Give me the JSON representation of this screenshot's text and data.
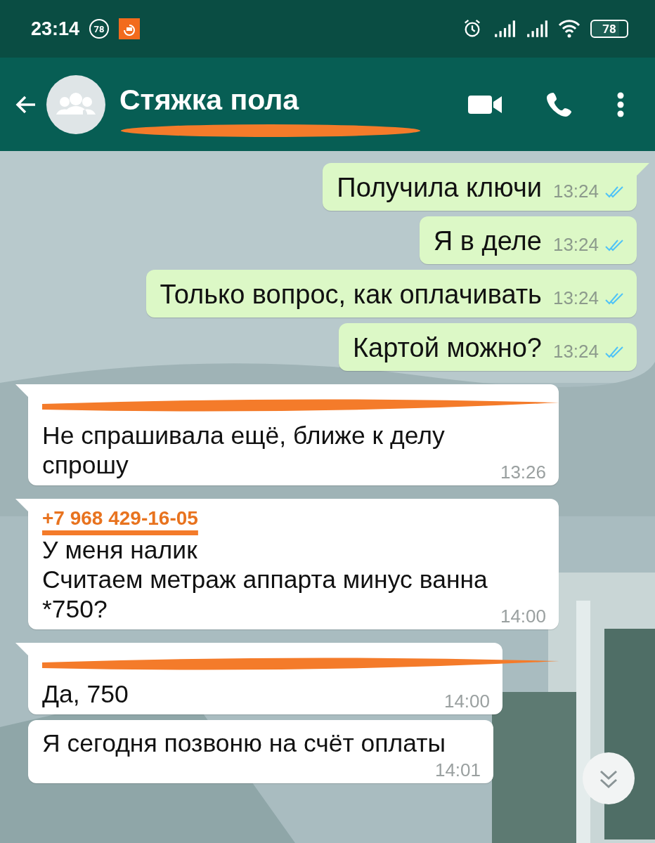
{
  "status_bar": {
    "time": "23:14",
    "notification_count": "78",
    "battery": "78"
  },
  "header": {
    "title": "Стяжка пола",
    "subtitle_redacted": true
  },
  "messages": [
    {
      "kind": "outgoing",
      "text": "Получила ключи",
      "time": "13:24",
      "read": true,
      "tail": true
    },
    {
      "kind": "outgoing",
      "text": "Я в деле",
      "time": "13:24",
      "read": true,
      "tail": false
    },
    {
      "kind": "outgoing",
      "text": "Только вопрос, как оплачивать",
      "time": "13:24",
      "read": true,
      "tail": false
    },
    {
      "kind": "outgoing",
      "text": "Картой можно?",
      "time": "13:24",
      "read": true,
      "tail": false
    },
    {
      "kind": "incoming",
      "sender": {
        "kind": "scribble"
      },
      "text": "Не спрашивала ещё, ближе к делу спрошу",
      "time": "13:26",
      "tail": true
    },
    {
      "kind": "incoming",
      "sender": {
        "kind": "struck",
        "text": "+7 968 429-16-05"
      },
      "text": "У меня налик\nСчитаем метраж аппарта минус ванна *750?",
      "time": "14:00",
      "tail": true
    },
    {
      "kind": "incoming",
      "sender": {
        "kind": "scribble"
      },
      "text": "Да, 750",
      "time": "14:00",
      "tail": true
    },
    {
      "kind": "incoming",
      "text": "Я сегодня позвоню на счёт оплаты",
      "time": "14:01",
      "tail": false
    }
  ]
}
